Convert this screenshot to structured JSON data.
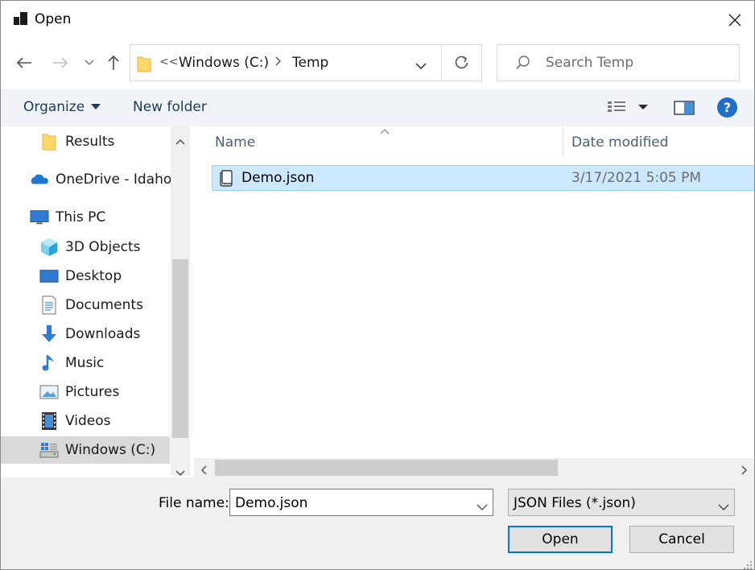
{
  "window": {
    "title": "Open"
  },
  "address": {
    "overflow": "<<",
    "segments": [
      "Windows (C:)",
      "Temp"
    ]
  },
  "search": {
    "placeholder": "Search Temp"
  },
  "toolbar": {
    "organize": "Organize",
    "new_folder": "New folder",
    "help": "?"
  },
  "nav": {
    "items": [
      {
        "label": "Results",
        "icon": "folder-icon"
      },
      {
        "label": "OneDrive - Idaho",
        "icon": "onedrive-icon"
      },
      {
        "label": "This PC",
        "icon": "computer-icon"
      },
      {
        "label": "3D Objects",
        "icon": "cube-icon"
      },
      {
        "label": "Desktop",
        "icon": "desktop-icon"
      },
      {
        "label": "Documents",
        "icon": "document-icon"
      },
      {
        "label": "Downloads",
        "icon": "download-icon"
      },
      {
        "label": "Music",
        "icon": "music-icon"
      },
      {
        "label": "Pictures",
        "icon": "pictures-icon"
      },
      {
        "label": "Videos",
        "icon": "videos-icon"
      },
      {
        "label": "Windows (C:)",
        "icon": "drive-icon"
      }
    ],
    "selected": "Windows (C:)"
  },
  "filelist": {
    "columns": {
      "name": "Name",
      "date": "Date modified"
    },
    "files": [
      {
        "name": "Demo.json",
        "date": "3/17/2021 5:05 PM",
        "selected": true
      }
    ]
  },
  "bottom": {
    "file_name_label": "File name:",
    "file_name_value": "Demo.json",
    "file_type_value": "JSON Files (*.json)",
    "open_label": "Open",
    "cancel_label": "Cancel"
  },
  "colors": {
    "selection_bg": "#cce8ff",
    "selection_border": "#99d1ff",
    "toolbar_bg": "#f0f4f9",
    "accent": "#0078d7"
  }
}
